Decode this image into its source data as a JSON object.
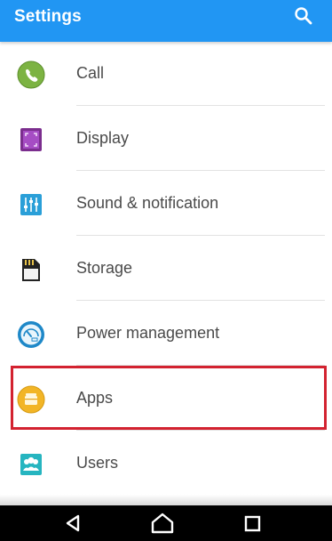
{
  "app_bar": {
    "title": "Settings",
    "search_icon": "search-icon"
  },
  "settings": [
    {
      "label": "Call",
      "icon": "call-icon",
      "color": "#7cb342"
    },
    {
      "label": "Display",
      "icon": "display-icon",
      "color": "#8e44ad"
    },
    {
      "label": "Sound & notification",
      "icon": "sound-notification-icon",
      "color": "#2a9fd8"
    },
    {
      "label": "Storage",
      "icon": "storage-icon",
      "color": "#222222"
    },
    {
      "label": "Power management",
      "icon": "power-management-icon",
      "color": "#1e88c8"
    },
    {
      "label": "Apps",
      "icon": "apps-icon",
      "color": "#f2b526",
      "highlighted": true
    },
    {
      "label": "Users",
      "icon": "users-icon",
      "color": "#26b5c0"
    }
  ],
  "highlight_color": "#d32230",
  "nav": {
    "back_icon": "back-icon",
    "home_icon": "home-icon",
    "recents_icon": "recents-icon"
  }
}
